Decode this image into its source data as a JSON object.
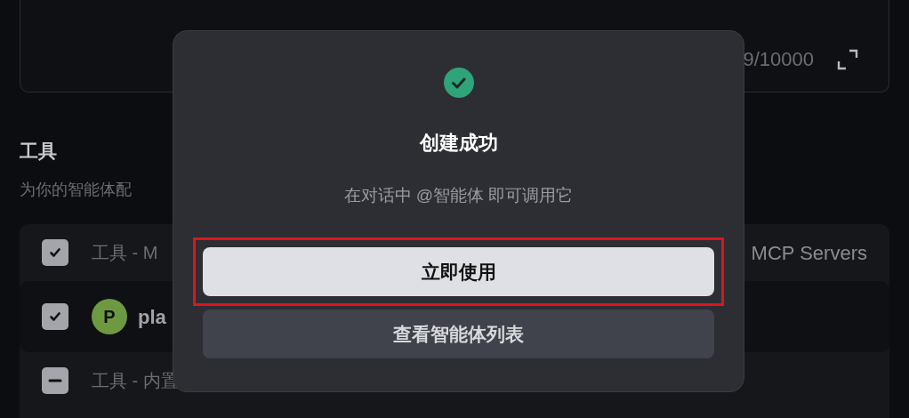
{
  "editor": {
    "counter": "9/10000"
  },
  "tools_section": {
    "title": "工具",
    "description": "为你的智能体配"
  },
  "tool_rows": [
    {
      "kind": "group",
      "checked": true,
      "indeterminate": false,
      "label": "工具 - M",
      "label_right": "MCP Servers"
    },
    {
      "kind": "server",
      "checked": true,
      "indeterminate": false,
      "avatar": "P",
      "label": "pla"
    },
    {
      "kind": "group",
      "checked": true,
      "indeterminate": true,
      "label": "工具 - 内置"
    }
  ],
  "dialog": {
    "title": "创建成功",
    "message": "在对话中 @智能体 即可调用它",
    "buttons": [
      {
        "label": "立即使用",
        "kind": "primary",
        "highlighted": true
      },
      {
        "label": "查看智能体列表",
        "kind": "secondary",
        "highlighted": false
      }
    ]
  }
}
